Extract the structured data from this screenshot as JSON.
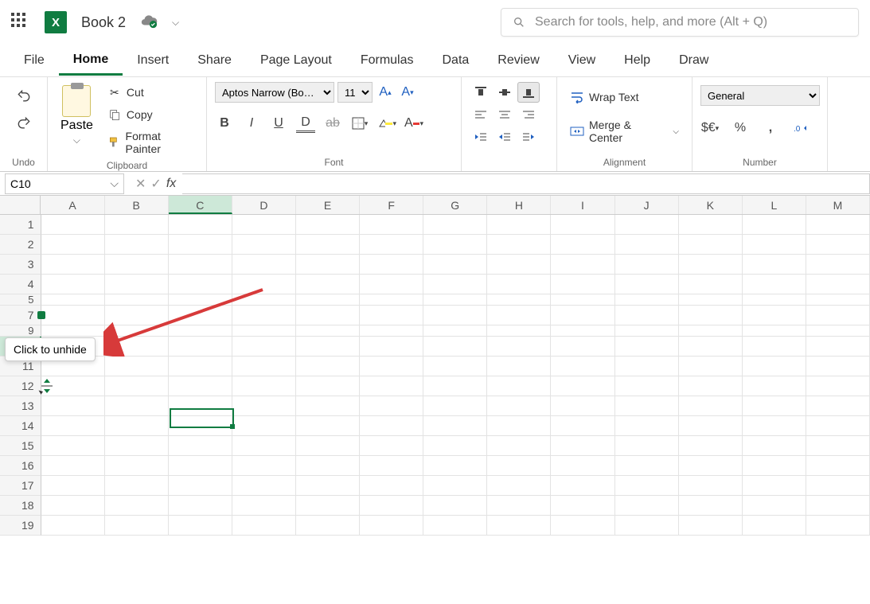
{
  "title": {
    "book_name": "Book 2"
  },
  "search": {
    "placeholder": "Search for tools, help, and more (Alt + Q)"
  },
  "tabs": [
    "File",
    "Home",
    "Insert",
    "Share",
    "Page Layout",
    "Formulas",
    "Data",
    "Review",
    "View",
    "Help",
    "Draw"
  ],
  "active_tab": "Home",
  "ribbon": {
    "undo_label": "Undo",
    "clipboard": {
      "paste": "Paste",
      "cut": "Cut",
      "copy": "Copy",
      "format_painter": "Format Painter",
      "group": "Clipboard"
    },
    "font": {
      "name": "Aptos Narrow (Bo…",
      "size": "11",
      "group": "Font"
    },
    "alignment": {
      "wrap": "Wrap Text",
      "merge": "Merge & Center",
      "group": "Alignment"
    },
    "number": {
      "format": "General",
      "group": "Number"
    }
  },
  "formula_bar": {
    "name_box": "C10",
    "formula": ""
  },
  "grid": {
    "columns": [
      "A",
      "B",
      "C",
      "D",
      "E",
      "F",
      "G",
      "H",
      "I",
      "J",
      "K",
      "L",
      "M"
    ],
    "rows_visible": [
      "1",
      "2",
      "3",
      "4",
      "5",
      "7",
      "9",
      "10",
      "11",
      "12",
      "13",
      "14",
      "15",
      "16",
      "17",
      "18",
      "19"
    ],
    "selected_cell": "C10",
    "selected_col": "C",
    "selected_row": "10"
  },
  "tooltip": {
    "text": "Click to unhide"
  }
}
